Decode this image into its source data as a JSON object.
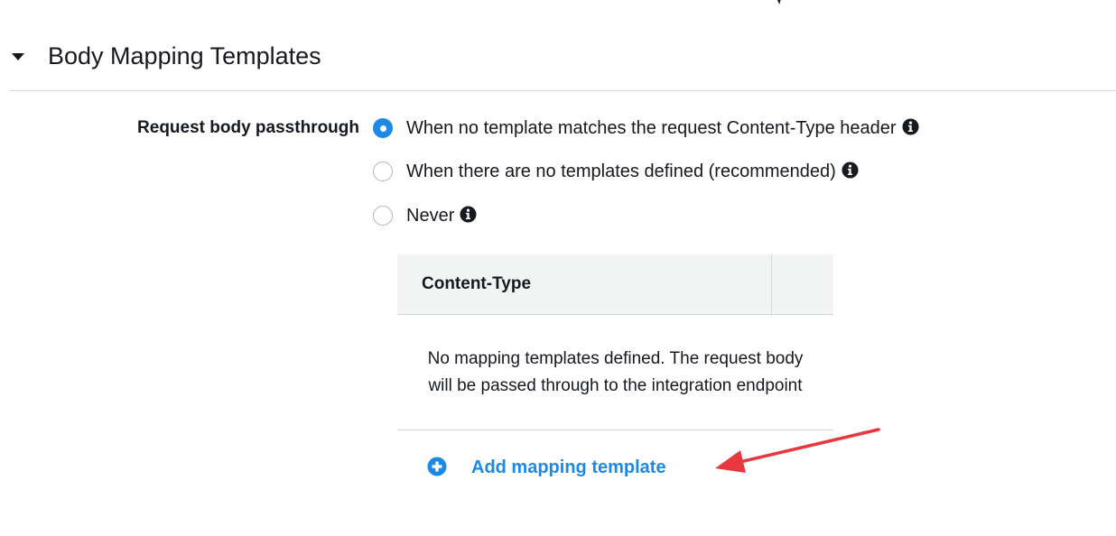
{
  "section": {
    "title": "Body Mapping Templates",
    "expanded": true
  },
  "passthrough": {
    "label": "Request body passthrough",
    "options": [
      {
        "label": "When no template matches the request Content-Type header",
        "selected": true,
        "has_info_icon": true
      },
      {
        "label": "When there are no templates defined (recommended)",
        "selected": false,
        "has_info_icon": true
      },
      {
        "label": "Never",
        "selected": false,
        "has_info_icon": true
      }
    ]
  },
  "table": {
    "header": "Content-Type",
    "empty_message": "No mapping templates defined. The request body will be passed through to the integration endpoint"
  },
  "add_template": {
    "label": "Add mapping template",
    "icon": "plus-circle-icon"
  },
  "annotation": {
    "icon": "red-arrow-icon",
    "color": "#e8383d"
  },
  "colors": {
    "accent": "#1e8ae6",
    "link": "#1e88e5",
    "text": "#16191f",
    "divider": "#d5dbdb",
    "table_header_bg": "#f2f3f3"
  }
}
